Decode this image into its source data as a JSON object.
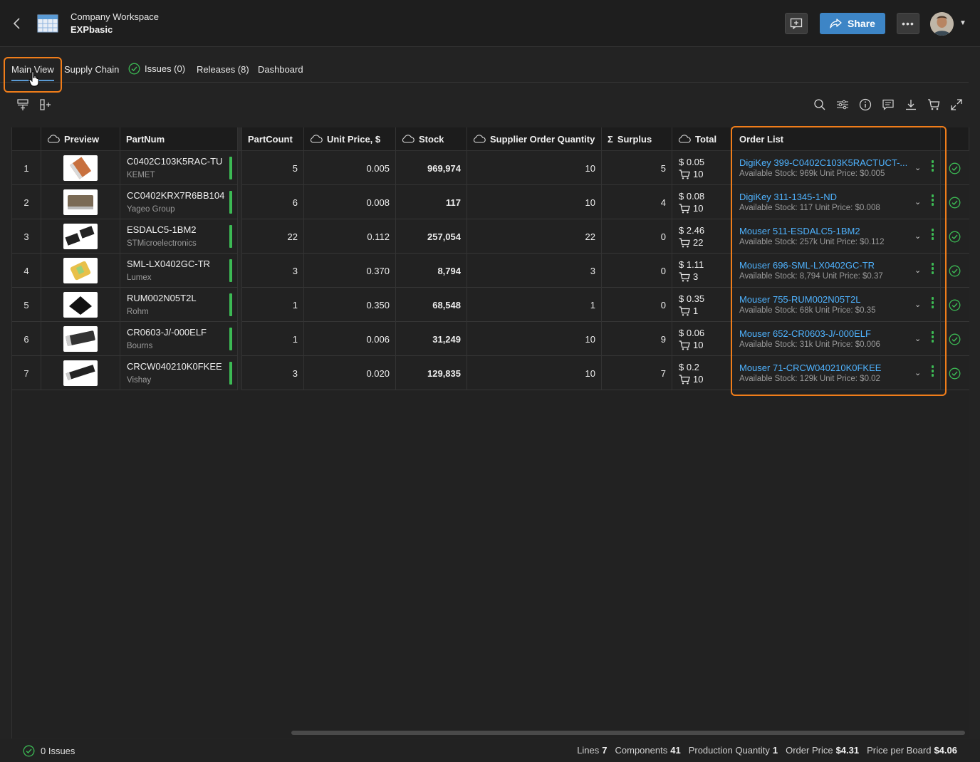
{
  "header": {
    "workspace_label": "Company Workspace",
    "project_name": "EXPbasic",
    "share_label": "Share",
    "more_label": "•••"
  },
  "tabs": [
    {
      "label": "Main View",
      "active": true
    },
    {
      "label": "Supply Chain"
    },
    {
      "label": "Issues (0)"
    },
    {
      "label": "Releases (8)"
    },
    {
      "label": "Dashboard"
    }
  ],
  "columns": {
    "preview": "Preview",
    "partnum": "PartNum",
    "partcount": "PartCount",
    "unit_price": "Unit Price, $",
    "stock": "Stock",
    "soq": "Supplier Order Quantity",
    "surplus": "Surplus",
    "total": "Total",
    "order_list": "Order List",
    "surplus_symbol": "Σ"
  },
  "rows": [
    {
      "idx": "1",
      "part": "C0402C103K5RAC-TU",
      "mfr": "KEMET",
      "count": "5",
      "price": "0.005",
      "stock": "969,974",
      "soq": "10",
      "surplus": "5",
      "total": "$ 0.05",
      "qty": "10",
      "supplier": "DigiKey 399-C0402C103K5RACTUCT-...",
      "avail": "Available Stock: 969k   Unit Price: $0.005"
    },
    {
      "idx": "2",
      "part": "CC0402KRX7R6BB104",
      "mfr": "Yageo Group",
      "count": "6",
      "price": "0.008",
      "stock": "117",
      "soq": "10",
      "surplus": "4",
      "total": "$ 0.08",
      "qty": "10",
      "supplier": "DigiKey 311-1345-1-ND",
      "avail": "Available Stock: 117   Unit Price: $0.008"
    },
    {
      "idx": "3",
      "part": "ESDALC5-1BM2",
      "mfr": "STMicroelectronics",
      "count": "22",
      "price": "0.112",
      "stock": "257,054",
      "soq": "22",
      "surplus": "0",
      "total": "$ 2.46",
      "qty": "22",
      "supplier": "Mouser 511-ESDALC5-1BM2",
      "avail": "Available Stock: 257k   Unit Price: $0.112"
    },
    {
      "idx": "4",
      "part": "SML-LX0402GC-TR",
      "mfr": "Lumex",
      "count": "3",
      "price": "0.370",
      "stock": "8,794",
      "soq": "3",
      "surplus": "0",
      "total": "$ 1.11",
      "qty": "3",
      "supplier": "Mouser 696-SML-LX0402GC-TR",
      "avail": "Available Stock: 8,794   Unit Price: $0.37"
    },
    {
      "idx": "5",
      "part": "RUM002N05T2L",
      "mfr": "Rohm",
      "count": "1",
      "price": "0.350",
      "stock": "68,548",
      "soq": "1",
      "surplus": "0",
      "total": "$ 0.35",
      "qty": "1",
      "supplier": "Mouser 755-RUM002N05T2L",
      "avail": "Available Stock: 68k   Unit Price: $0.35"
    },
    {
      "idx": "6",
      "part": "CR0603-J/-000ELF",
      "mfr": "Bourns",
      "count": "1",
      "price": "0.006",
      "stock": "31,249",
      "soq": "10",
      "surplus": "9",
      "total": "$ 0.06",
      "qty": "10",
      "supplier": "Mouser 652-CR0603-J/-000ELF",
      "avail": "Available Stock: 31k   Unit Price: $0.006"
    },
    {
      "idx": "7",
      "part": "CRCW040210K0FKEE",
      "mfr": "Vishay",
      "count": "3",
      "price": "0.020",
      "stock": "129,835",
      "soq": "10",
      "surplus": "7",
      "total": "$ 0.2",
      "qty": "10",
      "supplier": "Mouser 71-CRCW040210K0FKEE",
      "avail": "Available Stock: 129k   Unit Price: $0.02"
    }
  ],
  "status": {
    "issues": "0 Issues",
    "lines_label": "Lines",
    "lines": "7",
    "components_label": "Components",
    "components": "41",
    "prodqty_label": "Production Quantity",
    "prodqty": "1",
    "orderprice_label": "Order Price",
    "orderprice": "$4.31",
    "ppb_label": "Price per Board",
    "ppb": "$4.06"
  },
  "colors": {
    "accent": "#3d85c6",
    "link": "#4fb3ff",
    "ok": "#3cba54",
    "highlight": "#f07d1a"
  }
}
